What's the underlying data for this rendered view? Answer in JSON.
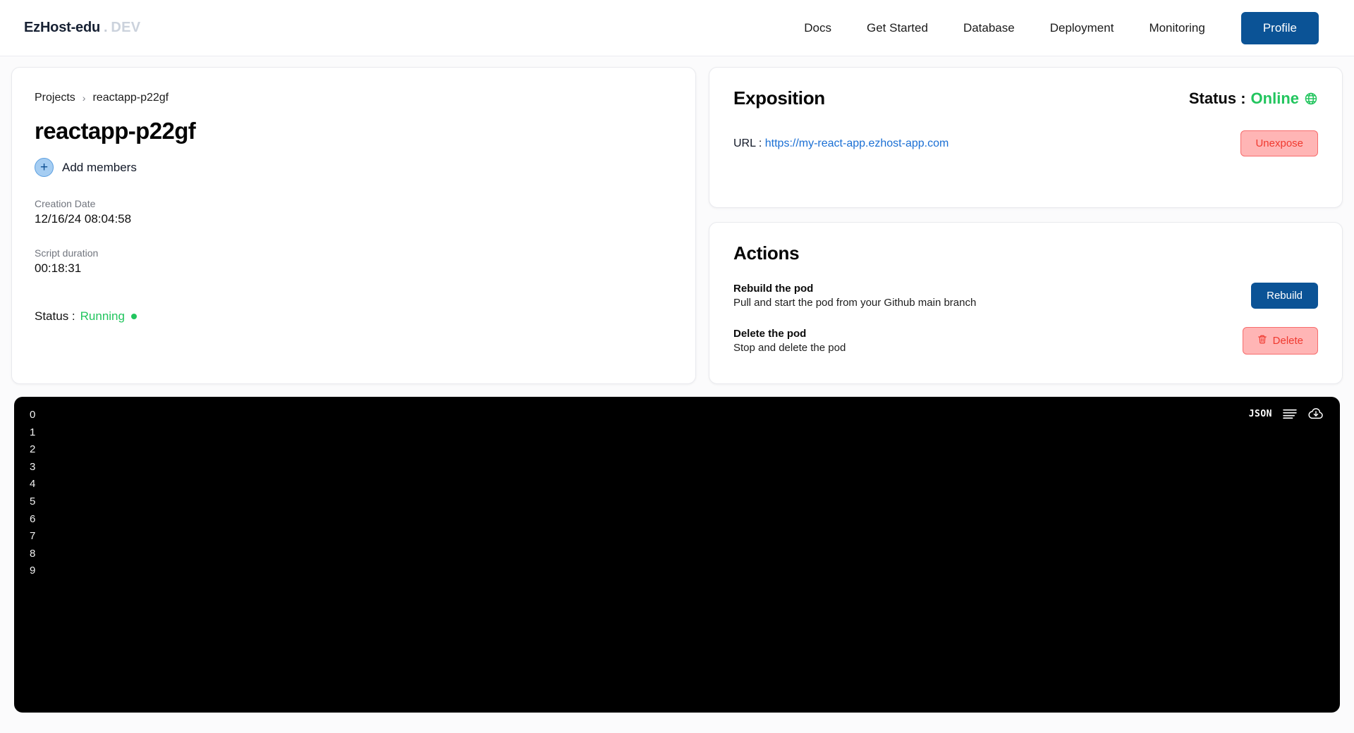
{
  "header": {
    "brand_main": "EzHost-edu",
    "brand_dot": ".",
    "brand_env": "DEV",
    "nav": [
      {
        "label": "Docs",
        "name": "docs"
      },
      {
        "label": "Get Started",
        "name": "get-started"
      },
      {
        "label": "Database",
        "name": "database"
      },
      {
        "label": "Deployment",
        "name": "deployment"
      },
      {
        "label": "Monitoring",
        "name": "monitoring"
      }
    ],
    "profile_label": "Profile",
    "profile_color": "#0b5396"
  },
  "project": {
    "breadcrumb_root": "Projects",
    "breadcrumb_sep": "›",
    "breadcrumb_current": "reactapp-p22gf",
    "title": "reactapp-p22gf",
    "add_members_label": "Add members",
    "plus_glyph": "+",
    "creation_date_label": "Creation Date",
    "creation_date_value": "12/16/24 08:04:58",
    "script_duration_label": "Script duration",
    "script_duration_value": "00:18:31",
    "status_label": "Status :",
    "status_value": "Running",
    "status_color": "#22c55e"
  },
  "exposition": {
    "title": "Exposition",
    "status_label": "Status :",
    "status_value": "Online",
    "status_color": "#22c55e",
    "url_label": "URL :",
    "url_value": "https://my-react-app.ezhost-app.com",
    "unexpose_label": "Unexpose",
    "danger_color": "#f0392f"
  },
  "actions": {
    "title": "Actions",
    "rows": [
      {
        "name": "Rebuild the pod",
        "desc": "Pull and start the pod from your Github main branch",
        "button": "Rebuild"
      },
      {
        "name": "Delete the pod",
        "desc": "Stop and delete the pod",
        "button": "Delete"
      }
    ]
  },
  "console": {
    "json_label": "JSON",
    "lines": [
      "0",
      "1",
      "2",
      "3",
      "4",
      "5",
      "6",
      "7",
      "8",
      "9"
    ]
  }
}
